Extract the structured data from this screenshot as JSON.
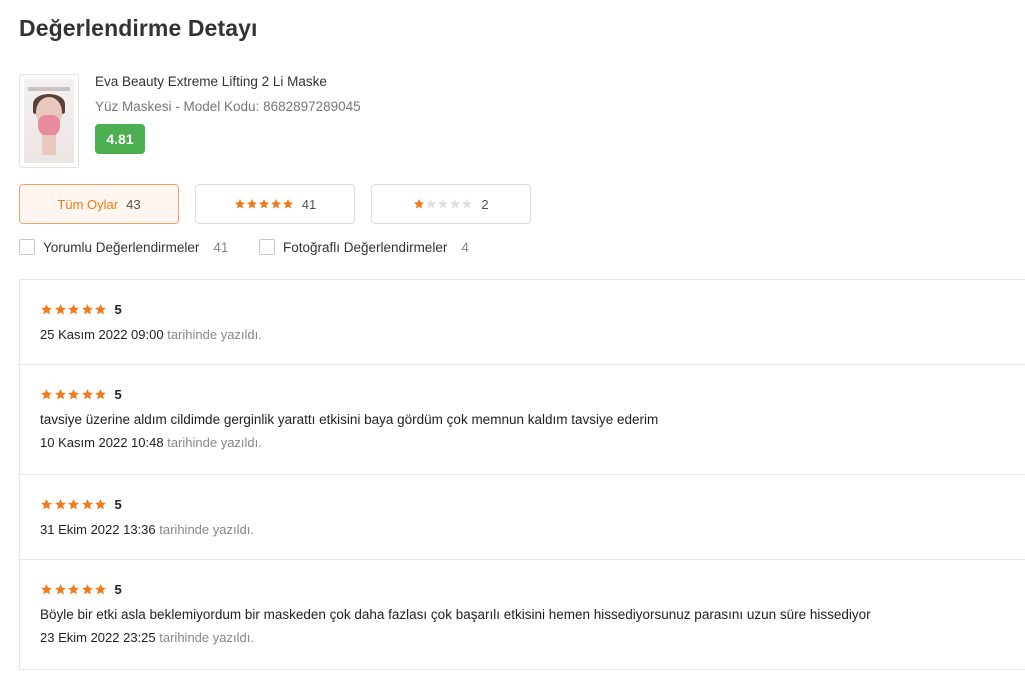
{
  "page": {
    "title": "Değerlendirme Detayı"
  },
  "product": {
    "name": "Eva Beauty Extreme Lifting 2 Li Maske",
    "meta": "Yüz Maskesi - Model Kodu: 8682897289045",
    "rating": "4.81",
    "thumbnail_icon": "product-image"
  },
  "colors": {
    "accent": "#f27a1a",
    "star": "#f27a1a",
    "star_empty": "#e0e0e0",
    "rating_badge": "#4caf50"
  },
  "filters": [
    {
      "label": "Tüm Oylar",
      "count": "43",
      "active": true
    },
    {
      "stars": 5,
      "count": "41",
      "active": false
    },
    {
      "stars": 1,
      "count": "2",
      "active": false
    }
  ],
  "checkboxes": [
    {
      "label": "Yorumlu Değerlendirmeler",
      "count": "41",
      "checked": false
    },
    {
      "label": "Fotoğraflı Değerlendirmeler",
      "count": "4",
      "checked": false
    }
  ],
  "date_suffix": "tarihinde yazıldı.",
  "reviews": [
    {
      "stars": 5,
      "score": "5",
      "comment": "",
      "date": "25 Kasım 2022 09:00"
    },
    {
      "stars": 5,
      "score": "5",
      "comment": "tavsiye üzerine aldım cildimde gerginlik yarattı etkisini baya gördüm çok memnun kaldım tavsiye ederim",
      "date": "10 Kasım 2022 10:48"
    },
    {
      "stars": 5,
      "score": "5",
      "comment": "",
      "date": "31 Ekim 2022 13:36"
    },
    {
      "stars": 5,
      "score": "5",
      "comment": "Böyle bir etki asla beklemiyordum bir maskeden çok daha fazlası çok başarılı etkisini hemen hissediyorsunuz parasını uzun süre hissediyor",
      "date": "23 Ekim 2022 23:25"
    }
  ]
}
